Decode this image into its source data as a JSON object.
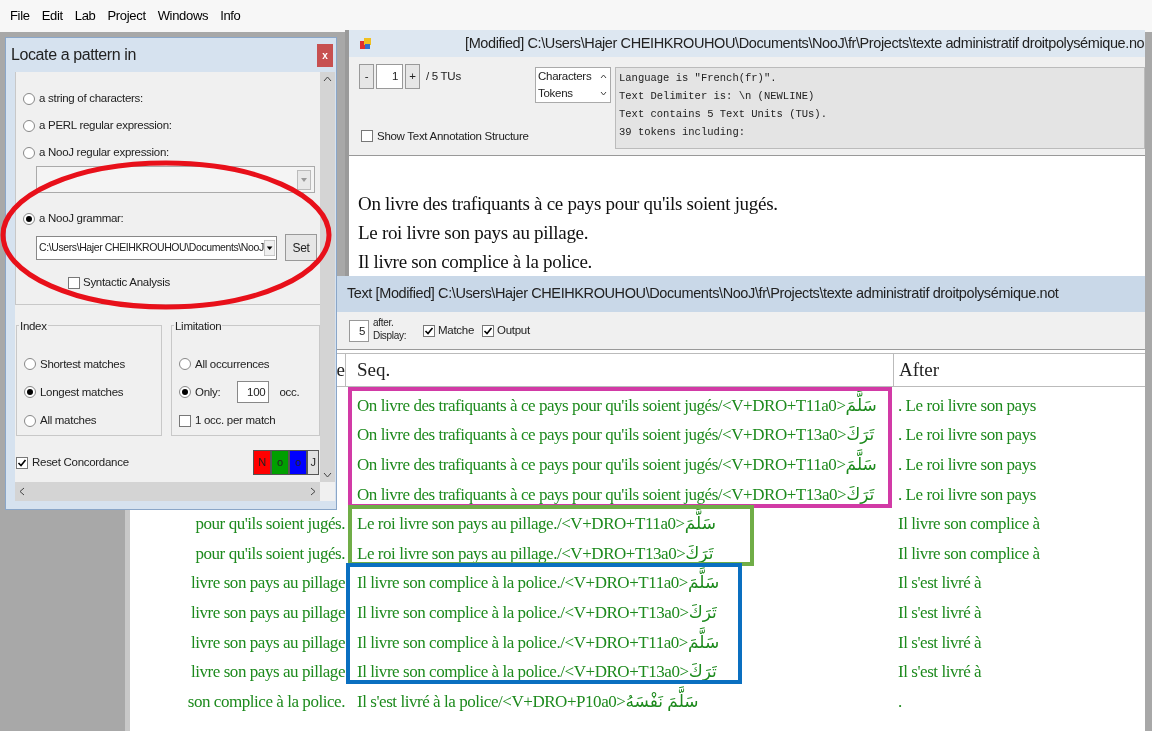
{
  "menu": [
    "File",
    "Edit",
    "Lab",
    "Project",
    "Windows",
    "Info"
  ],
  "locate_dialog": {
    "title": "Locate a pattern in",
    "close": "x",
    "pattern_options": [
      {
        "label": "a string of characters:",
        "selected": false
      },
      {
        "label": "a PERL regular expression:",
        "selected": false
      },
      {
        "label": "a NooJ regular expression:",
        "selected": false
      },
      {
        "label": "a NooJ grammar:",
        "selected": true
      }
    ],
    "grammar_path": "C:\\Users\\Hajer CHEIHKROUHOU\\Documents\\NooJ",
    "set_button": "Set",
    "syntactic_analysis": {
      "label": "Syntactic Analysis",
      "checked": false
    },
    "index": {
      "title": "Index",
      "options": [
        {
          "label": "Shortest matches",
          "selected": false
        },
        {
          "label": "Longest matches",
          "selected": true
        },
        {
          "label": "All matches",
          "selected": false
        }
      ]
    },
    "limitation": {
      "title": "Limitation",
      "options": [
        {
          "label": "All occurrences",
          "selected": false
        },
        {
          "label": "Only:",
          "selected": true
        }
      ],
      "only_value": "100",
      "occ_label": "occ.",
      "per_match": {
        "label": "1 occ. per match",
        "checked": false
      }
    },
    "reset_concordance": {
      "label": "Reset Concordance",
      "checked": true
    },
    "color_buttons": [
      {
        "label": "N",
        "color": "#ff0000"
      },
      {
        "label": "o",
        "color": "#00a000"
      },
      {
        "label": "o",
        "color": "#0000ff"
      },
      {
        "label": "J",
        "color": "#e0e0e0"
      }
    ]
  },
  "text_window": {
    "title": "[Modified] C:\\Users\\Hajer CHEIHKROUHOU\\Documents\\NooJ\\fr\\Projects\\texte administratif droitpolysémique.no",
    "tu_minus": "-",
    "tu_value": "1",
    "tu_plus": "+",
    "tu_total": "/ 5 TUs",
    "list_items": [
      "Characters",
      "Tokens"
    ],
    "info_lines": [
      "Language is \"French(fr)\".",
      "Text Delimiter is: \\n (NEWLINE)",
      "Text contains 5 Text Units (TUs).",
      "39 tokens including:"
    ],
    "show_annotation": {
      "label": "Show Text Annotation Structure",
      "checked": false
    },
    "text_lines": [
      "On livre des trafiquants à ce pays pour qu'ils soient jugés.",
      "Le roi livre son pays au pillage.",
      "Il livre son complice à la police."
    ]
  },
  "concordance": {
    "title": "Text [Modified] C:\\Users\\Hajer CHEIHKROUHOU\\Documents\\NooJ\\fr\\Projects\\texte administratif droitpolysémique.not",
    "display_value": "5",
    "display_label": [
      "after.",
      "Display:"
    ],
    "matche": {
      "label": "Matche",
      "checked": true
    },
    "output": {
      "label": "Output",
      "checked": true
    },
    "columns": [
      "e",
      "Seq.",
      "After"
    ],
    "rows": [
      {
        "seq": "On livre des trafiquants à ce pays pour qu'ils soient jugés/<V+DRO+T11a0>سَلَّمَ",
        "after": ". Le roi livre son pays"
      },
      {
        "seq": "On livre des trafiquants à ce pays pour qu'ils soient jugés/<V+DRO+T13a0>تَرَكَ",
        "after": ". Le roi livre son pays"
      },
      {
        "seq": "On livre des trafiquants à ce pays pour qu'ils soient jugés/<V+DRO+T11a0>سَلَّمَ",
        "after": ". Le roi livre son pays"
      },
      {
        "seq": "On livre des trafiquants à ce pays pour qu'ils soient jugés/<V+DRO+T13a0>تَرَكَ",
        "after": ". Le roi livre son pays"
      },
      {
        "before": "pour qu'ils soient jugés.",
        "seq": "Le roi livre son pays au pillage./<V+DRO+T11a0>سَلَّمَ",
        "after": "Il livre son complice à"
      },
      {
        "before": "pour qu'ils soient jugés.",
        "seq": "Le roi livre son pays au pillage./<V+DRO+T13a0>تَرَكَ",
        "after": "Il livre son complice à"
      },
      {
        "before": "livre son pays au pillage",
        "seq": "Il livre son complice à la police./<V+DRO+T11a0>سَلَّمَ",
        "after": "Il s'est livré à"
      },
      {
        "before": "livre son pays au pillage",
        "seq": "Il livre son complice à la police./<V+DRO+T13a0>تَرَكَ",
        "after": "Il s'est livré à"
      },
      {
        "before": "livre son pays au pillage",
        "seq": "Il livre son complice à la police./<V+DRO+T11a0>سَلَّمَ",
        "after": "Il s'est livré à"
      },
      {
        "before": "livre son pays au pillage",
        "seq": "Il livre son complice à la police./<V+DRO+T13a0>تَرَكَ",
        "after": "Il s'est livré à"
      },
      {
        "before": "son complice à la police.",
        "seq": "Il s'est livré à la police/<V+DRO+P10a0>سَلَّمَ نَفْسَهُ",
        "after": "."
      }
    ]
  },
  "annotations": [
    {
      "kind": "ellipse",
      "color": "#e8101a"
    },
    {
      "kind": "frame",
      "color": "#d23aa6"
    },
    {
      "kind": "frame",
      "color": "#70ad47"
    },
    {
      "kind": "frame",
      "color": "#0a6fc0"
    }
  ]
}
